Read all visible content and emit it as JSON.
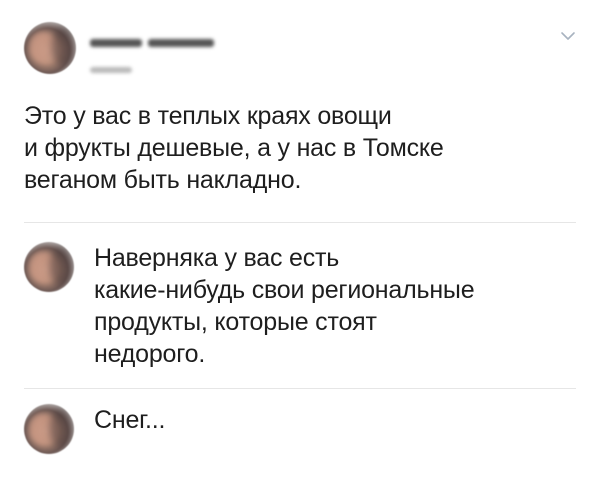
{
  "post": {
    "text": "Это у вас в теплых краях овощи\nи фрукты дешевые, а у нас в Томске\nвеганом быть накладно."
  },
  "comments": [
    {
      "text": "Наверняка у вас есть\nкакие-нибудь свои региональные\nпродукты, которые стоят\nнедорого."
    },
    {
      "text": "Снег..."
    }
  ],
  "icons": {
    "menu": "chevron-down-icon",
    "avatar": "avatar"
  },
  "colors": {
    "text": "#1e1e1e",
    "divider": "#e6e6e6",
    "chevron": "#a8b3c0"
  }
}
